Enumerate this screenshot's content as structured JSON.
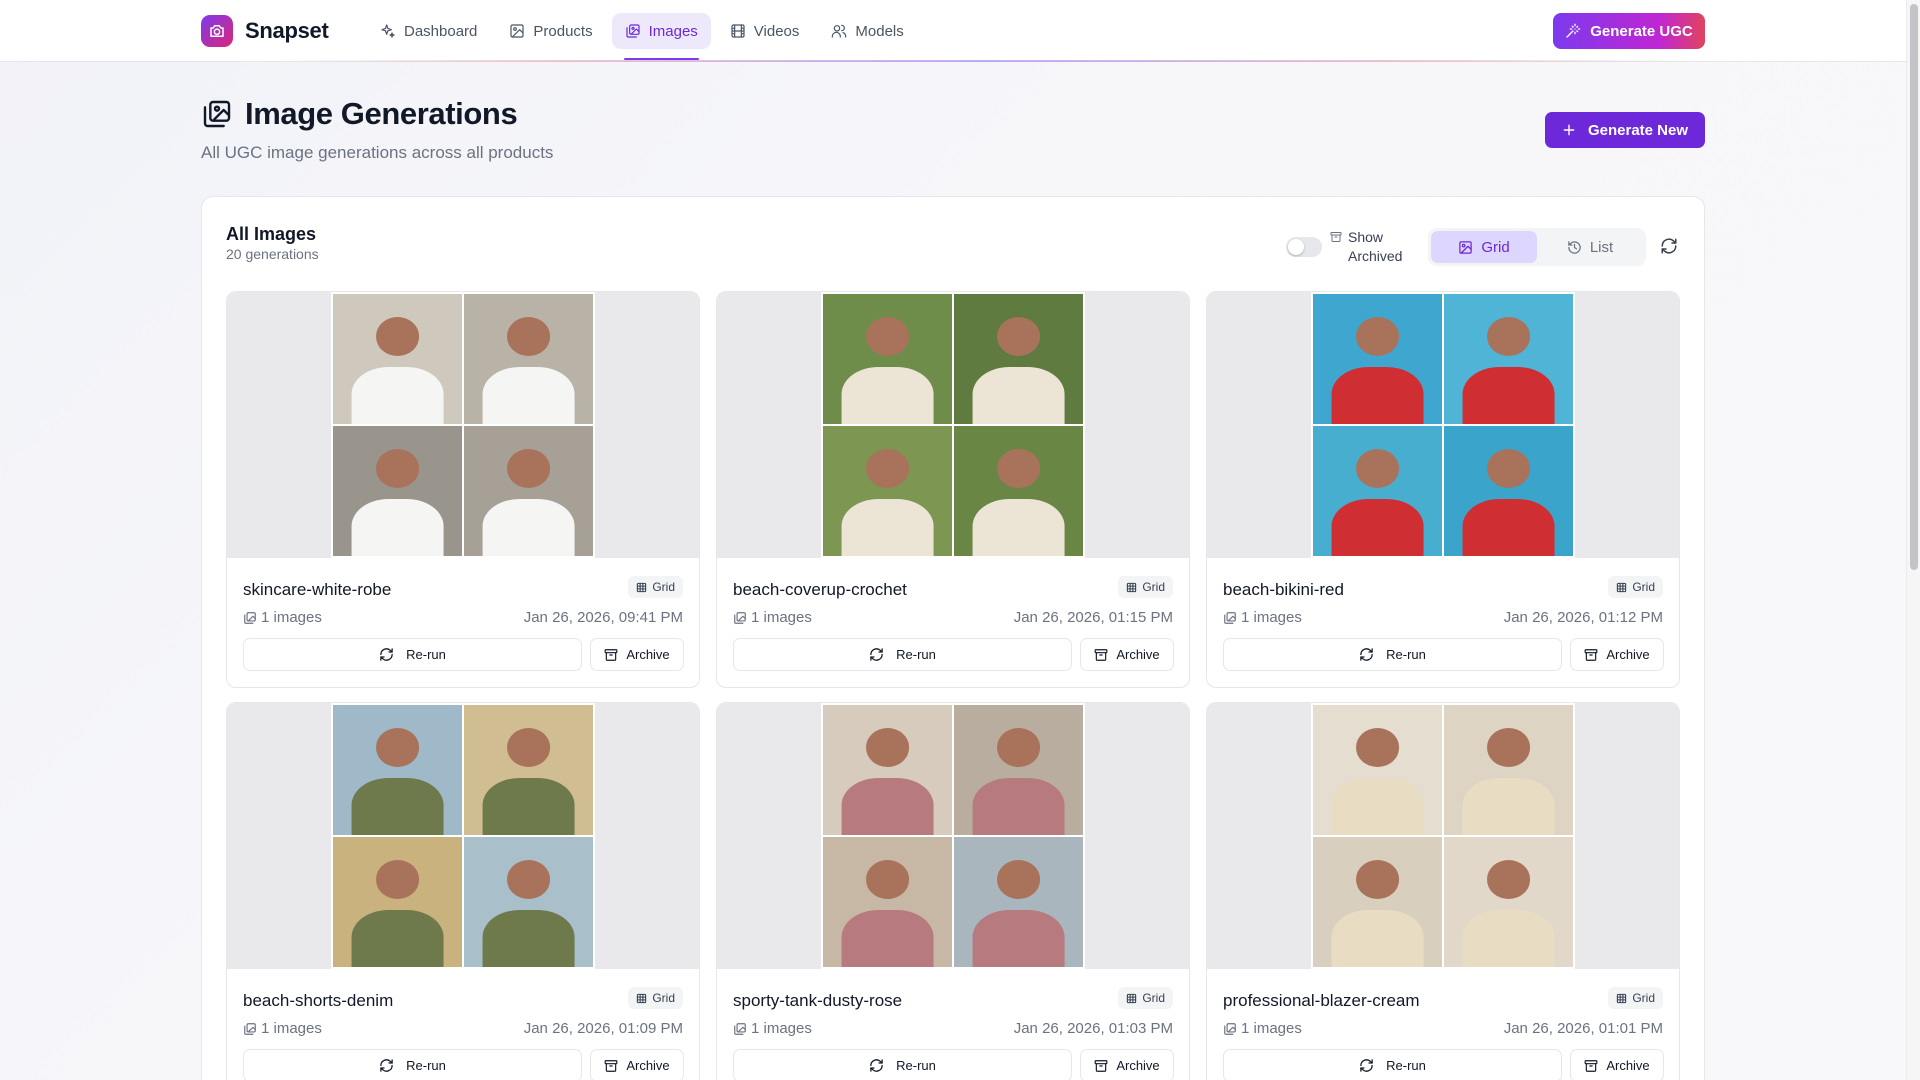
{
  "app": {
    "brand": "Snapset",
    "generate_ugc": "Generate UGC"
  },
  "nav": {
    "items": [
      {
        "label": "Dashboard",
        "icon": "sparkles-icon",
        "active": false
      },
      {
        "label": "Products",
        "icon": "image-icon",
        "active": false
      },
      {
        "label": "Images",
        "icon": "images-icon",
        "active": true
      },
      {
        "label": "Videos",
        "icon": "film-icon",
        "active": false
      },
      {
        "label": "Models",
        "icon": "users-icon",
        "active": false
      }
    ]
  },
  "page": {
    "title": "Image Generations",
    "subtitle": "All UGC image generations across all products",
    "generate_new": "Generate New"
  },
  "panel": {
    "title": "All Images",
    "count": "20 generations",
    "show_archived_label": "Show Archived",
    "show_archived": false,
    "view_grid": "Grid",
    "view_list": "List",
    "active_view": "Grid"
  },
  "cards": [
    {
      "name": "skincare-white-robe",
      "badge": "Grid",
      "count": "1 images",
      "date": "Jan 26, 2026, 09:41 PM",
      "rerun": "Re-run",
      "archive": "Archive",
      "bg": [
        "#cfc8bd",
        "#b9b2a7",
        "#9a958c",
        "#a7a096"
      ],
      "body": "#f5f5f3"
    },
    {
      "name": "beach-coverup-crochet",
      "badge": "Grid",
      "count": "1 images",
      "date": "Jan 26, 2026, 01:15 PM",
      "rerun": "Re-run",
      "archive": "Archive",
      "bg": [
        "#6f8d4a",
        "#5f7b3f",
        "#7d9652",
        "#6a8645"
      ],
      "body": "#ece5d6"
    },
    {
      "name": "beach-bikini-red",
      "badge": "Grid",
      "count": "1 images",
      "date": "Jan 26, 2026, 01:12 PM",
      "rerun": "Re-run",
      "archive": "Archive",
      "bg": [
        "#3fa7cf",
        "#4fb4d6",
        "#47aecf",
        "#3ba4cb"
      ],
      "body": "#cf2f33"
    },
    {
      "name": "beach-shorts-denim",
      "badge": "Grid",
      "count": "1 images",
      "date": "Jan 26, 2026, 01:09 PM",
      "rerun": "Re-run",
      "archive": "Archive",
      "bg": [
        "#9fb9c9",
        "#d1bd92",
        "#c9b27d",
        "#a9bfc9"
      ],
      "body": "#6f7a4c"
    },
    {
      "name": "sporty-tank-dusty-rose",
      "badge": "Grid",
      "count": "1 images",
      "date": "Jan 26, 2026, 01:03 PM",
      "rerun": "Re-run",
      "archive": "Archive",
      "bg": [
        "#d7cbbd",
        "#b9ad9f",
        "#c7b8a5",
        "#a9b6bd"
      ],
      "body": "#b77b7f"
    },
    {
      "name": "professional-blazer-cream",
      "badge": "Grid",
      "count": "1 images",
      "date": "Jan 26, 2026, 01:01 PM",
      "rerun": "Re-run",
      "archive": "Archive",
      "bg": [
        "#e5ddcf",
        "#ddd4c4",
        "#d9cfbe",
        "#e1d8c9"
      ],
      "body": "#e8dcc3"
    }
  ]
}
